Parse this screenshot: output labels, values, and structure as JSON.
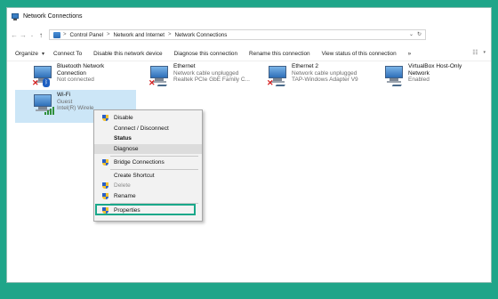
{
  "window": {
    "title": "Network Connections"
  },
  "address": {
    "crumbs": [
      "Control Panel",
      "Network and Internet",
      "Network Connections"
    ],
    "separator": ">"
  },
  "toolbar": {
    "items": [
      "Organize",
      "Connect To",
      "Disable this network device",
      "Diagnose this connection",
      "Rename this connection",
      "View status of this connection",
      "»"
    ]
  },
  "connections": [
    {
      "name1": "Bluetooth Network",
      "name2": "Connection",
      "status": "Not connected",
      "icon": "bluetooth-icon"
    },
    {
      "name1": "Ethernet",
      "status": "Network cable unplugged",
      "device": "Realtek PCIe GbE Family C...",
      "icon": "ethernet-icon"
    },
    {
      "name1": "Ethernet 2",
      "status": "Network cable unplugged",
      "device": "TAP-Windows Adapter V9",
      "icon": "ethernet-icon"
    },
    {
      "name1": "VirtualBox Host-Only",
      "name2": "Network",
      "status": "Enabled",
      "icon": "ethernet-icon"
    },
    {
      "name1": "Wi-Fi",
      "status": "Guest",
      "device": "Intel(R) Wirele",
      "icon": "wifi-icon"
    }
  ],
  "context_menu": {
    "items": [
      {
        "label": "Disable"
      },
      {
        "label": "Connect / Disconnect"
      },
      {
        "label": "Status"
      },
      {
        "label": "Diagnose"
      },
      {
        "label": "Bridge Connections"
      },
      {
        "label": "Create Shortcut"
      },
      {
        "label": "Delete"
      },
      {
        "label": "Rename"
      },
      {
        "label": "Properties"
      }
    ]
  },
  "colors": {
    "background": "#1fa589",
    "highlight_frame": "#1aa88a",
    "selection": "#cce6f7"
  }
}
